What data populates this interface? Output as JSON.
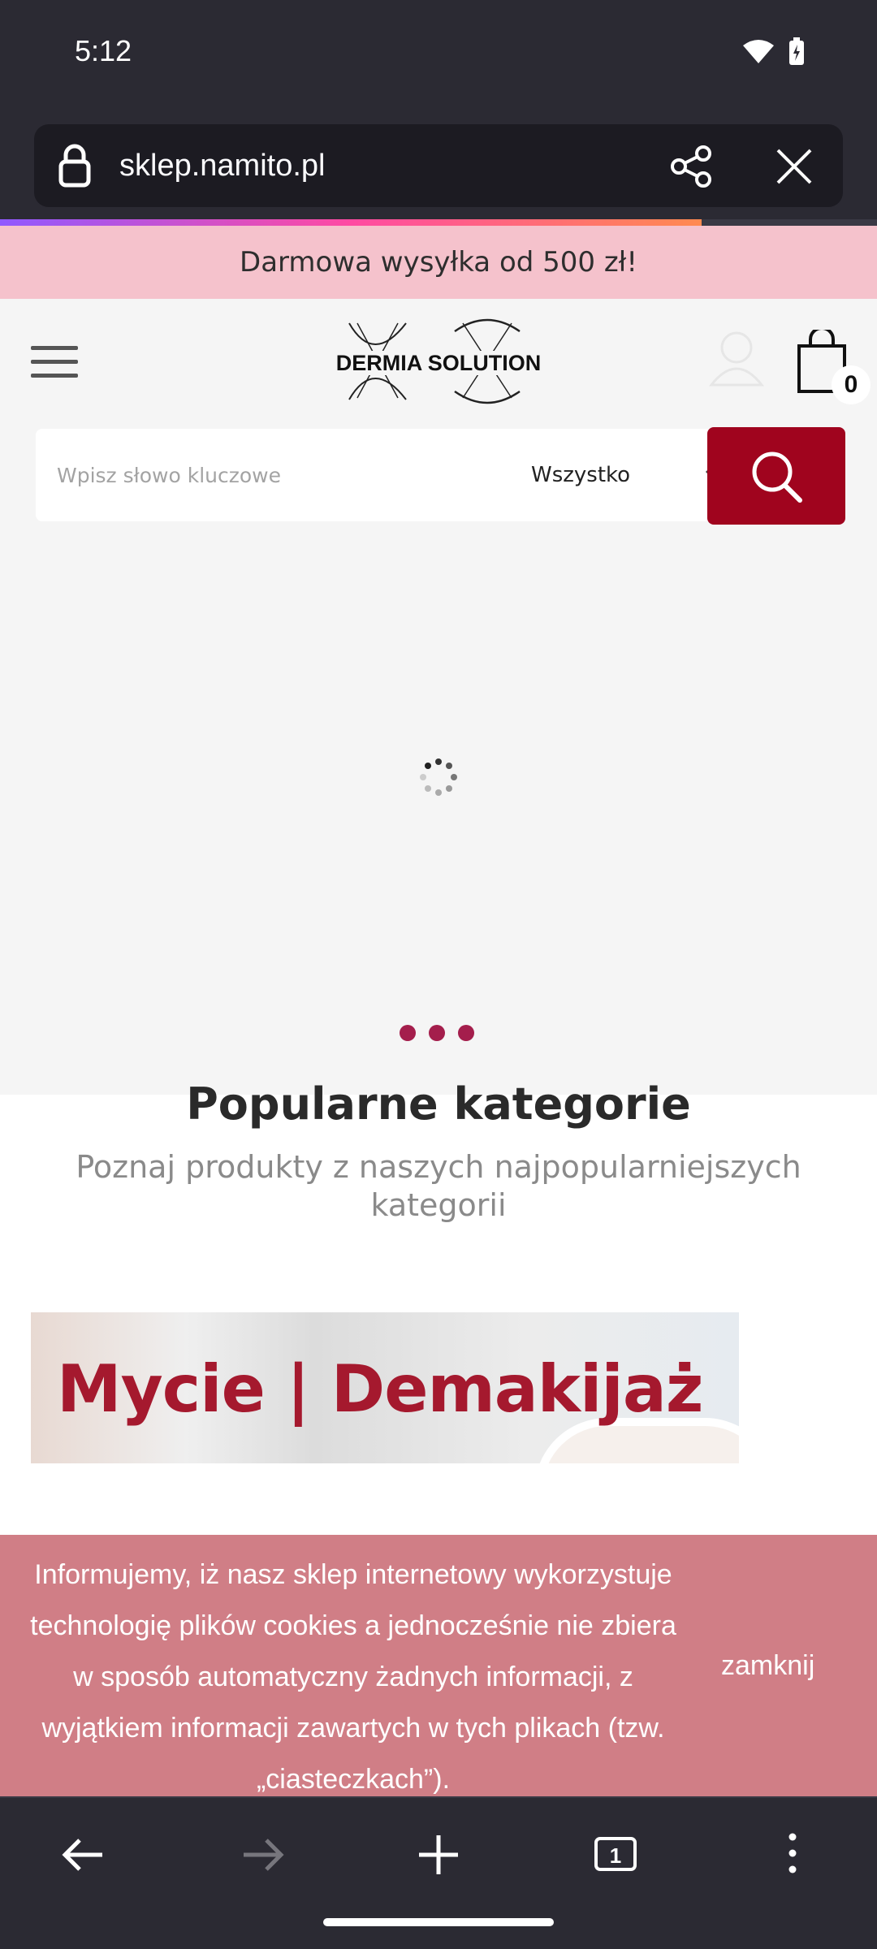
{
  "status_bar": {
    "time": "5:12"
  },
  "browser": {
    "url": "sklep.namito.pl",
    "progress_percent": 80,
    "nav": [
      "back",
      "forward-disabled",
      "new-tab",
      "tabs",
      "menu"
    ],
    "tab_count": "1"
  },
  "page": {
    "promo": "Darmowa wysyłka od 500 zł!",
    "logo_text": "DERMIA SOLUTION",
    "cart_count": "0",
    "search": {
      "placeholder": "Wpisz słowo kluczowe",
      "category": "Wszystko"
    },
    "section": {
      "title": "Popularne kategorie",
      "subtitle": "Poznaj produkty z naszych najpopularniejszych kategorii"
    },
    "banner_text": "Mycie | Demakijaż",
    "cookie": {
      "lines": [
        "Informujemy, iż nasz sklep internetowy wykorzystuje",
        "technologię plików cookies a jednocześnie nie zbiera",
        "w sposób automatyczny żadnych informacji, z",
        "wyjątkiem informacji zawartych w tych plikach (tzw.",
        "„ciasteczkach”)."
      ],
      "close_label": "zamknij"
    }
  },
  "colors": {
    "accent": "#a0041e",
    "promo_bg": "#f5c2cc",
    "cookie_bg": "#d07e86",
    "dots": "#a41e4c"
  }
}
